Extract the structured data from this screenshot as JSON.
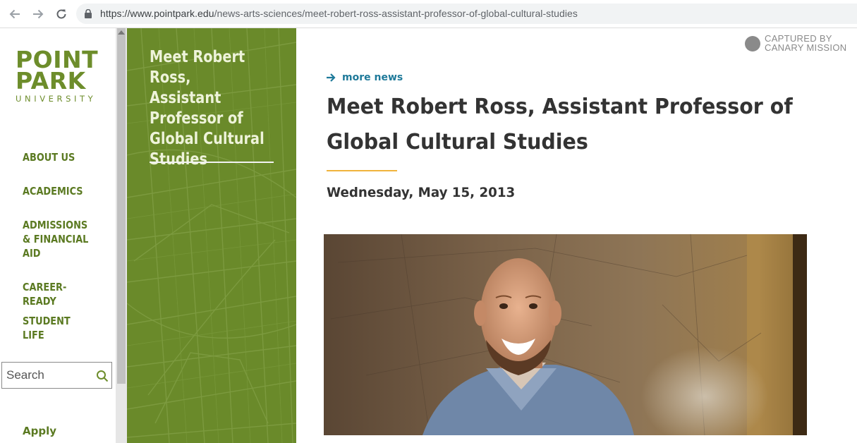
{
  "browser": {
    "url_domain": "https://www.pointpark.edu",
    "url_path": "/news-arts-sciences/meet-robert-ross-assistant-professor-of-global-cultural-studies",
    "back_icon": "arrow-left-icon",
    "forward_icon": "arrow-right-icon",
    "reload_icon": "reload-icon",
    "lock_icon": "lock-icon"
  },
  "logo": {
    "line1": "POINT",
    "line2": "PARK",
    "line3": "UNIVERSITY",
    "color": "#6d8d2b"
  },
  "sidebar": {
    "items": [
      {
        "label": "ABOUT US"
      },
      {
        "label": "ACADEMICS"
      },
      {
        "label": "ADMISSIONS & FINANCIAL AID"
      },
      {
        "label": "CAREER-READY"
      },
      {
        "label": "STUDENT LIFE"
      }
    ],
    "search_placeholder": "Search",
    "apply_label": "Apply"
  },
  "panel": {
    "title": "Meet Robert Ross, Assistant Professor of Global Cultural Studies",
    "color": "#6a8a2a"
  },
  "watermark": {
    "line1": "CAPTURED BY",
    "line2": "CANARY MISSION"
  },
  "article": {
    "more_news": "more news",
    "title": "Meet Robert Ross, Assistant Professor of Global Cultural Studies",
    "date": "Wednesday, May 15, 2013",
    "accent_color": "#f0b43c",
    "link_color": "#1f7a9a"
  }
}
